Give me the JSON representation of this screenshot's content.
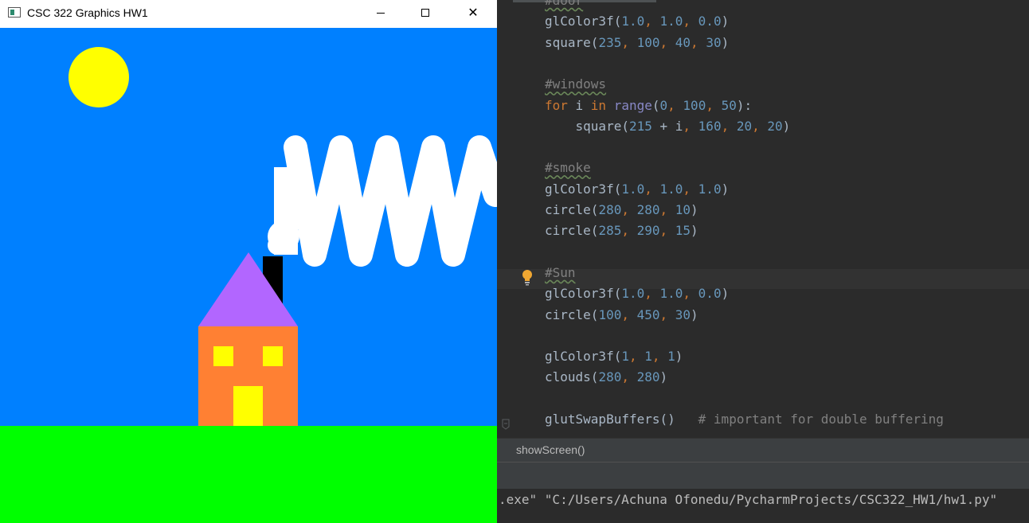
{
  "window": {
    "title": "CSC 322 Graphics HW1",
    "icon": "app-window-icon",
    "controls": [
      "minimize-icon",
      "maximize-icon",
      "close-icon"
    ],
    "close_glyph": "✕"
  },
  "scene": {
    "sky_color": "#0080ff",
    "grass_color": "#00ff00",
    "sun_color": "#ffff00",
    "house_color": "#ff8033",
    "roof_color": "#b266ff",
    "chimney_color": "#000000",
    "door_color": "#ffff00",
    "window_color": "#ffff00",
    "smoke_color": "#ffffff"
  },
  "editor": {
    "lines": [
      {
        "parts": [
          {
            "t": "#door",
            "c": "cm"
          }
        ]
      },
      {
        "parts": [
          {
            "t": "glColor3f("
          },
          {
            "t": "1.0",
            "c": "n"
          },
          {
            "t": ", ",
            "c": "p"
          },
          {
            "t": "1.0",
            "c": "n"
          },
          {
            "t": ", ",
            "c": "p"
          },
          {
            "t": "0.0",
            "c": "n"
          },
          {
            "t": ")"
          }
        ]
      },
      {
        "parts": [
          {
            "t": "square("
          },
          {
            "t": "235",
            "c": "n"
          },
          {
            "t": ", ",
            "c": "p"
          },
          {
            "t": "100",
            "c": "n"
          },
          {
            "t": ", ",
            "c": "p"
          },
          {
            "t": "40",
            "c": "n"
          },
          {
            "t": ", ",
            "c": "p"
          },
          {
            "t": "30",
            "c": "n"
          },
          {
            "t": ")"
          }
        ]
      },
      {
        "parts": []
      },
      {
        "parts": [
          {
            "t": "#windows",
            "c": "cm"
          }
        ]
      },
      {
        "parts": [
          {
            "t": "for ",
            "c": "k"
          },
          {
            "t": "i "
          },
          {
            "t": "in ",
            "c": "k"
          },
          {
            "t": "range",
            "c": "b"
          },
          {
            "t": "("
          },
          {
            "t": "0",
            "c": "n"
          },
          {
            "t": ", ",
            "c": "p"
          },
          {
            "t": "100",
            "c": "n"
          },
          {
            "t": ", ",
            "c": "p"
          },
          {
            "t": "50",
            "c": "n"
          },
          {
            "t": "):"
          }
        ]
      },
      {
        "parts": [
          {
            "t": "    square("
          },
          {
            "t": "215",
            "c": "n"
          },
          {
            "t": " + i"
          },
          {
            "t": ", ",
            "c": "p"
          },
          {
            "t": "160",
            "c": "n"
          },
          {
            "t": ", ",
            "c": "p"
          },
          {
            "t": "20",
            "c": "n"
          },
          {
            "t": ", ",
            "c": "p"
          },
          {
            "t": "20",
            "c": "n"
          },
          {
            "t": ")"
          }
        ]
      },
      {
        "parts": []
      },
      {
        "parts": [
          {
            "t": "#smoke",
            "c": "cm"
          }
        ]
      },
      {
        "parts": [
          {
            "t": "glColor3f("
          },
          {
            "t": "1.0",
            "c": "n"
          },
          {
            "t": ", ",
            "c": "p"
          },
          {
            "t": "1.0",
            "c": "n"
          },
          {
            "t": ", ",
            "c": "p"
          },
          {
            "t": "1.0",
            "c": "n"
          },
          {
            "t": ")"
          }
        ]
      },
      {
        "parts": [
          {
            "t": "circle("
          },
          {
            "t": "280",
            "c": "n"
          },
          {
            "t": ", ",
            "c": "p"
          },
          {
            "t": "280",
            "c": "n"
          },
          {
            "t": ", ",
            "c": "p"
          },
          {
            "t": "10",
            "c": "n"
          },
          {
            "t": ")"
          }
        ]
      },
      {
        "parts": [
          {
            "t": "circle("
          },
          {
            "t": "285",
            "c": "n"
          },
          {
            "t": ", ",
            "c": "p"
          },
          {
            "t": "290",
            "c": "n"
          },
          {
            "t": ", ",
            "c": "p"
          },
          {
            "t": "15",
            "c": "n"
          },
          {
            "t": ")"
          }
        ]
      },
      {
        "parts": []
      },
      {
        "parts": [
          {
            "t": "#Sun",
            "c": "cm"
          }
        ]
      },
      {
        "parts": [
          {
            "t": "glColor3f("
          },
          {
            "t": "1.0",
            "c": "n"
          },
          {
            "t": ", ",
            "c": "p"
          },
          {
            "t": "1.0",
            "c": "n"
          },
          {
            "t": ", ",
            "c": "p"
          },
          {
            "t": "0.0",
            "c": "n"
          },
          {
            "t": ")"
          }
        ]
      },
      {
        "parts": [
          {
            "t": "circle("
          },
          {
            "t": "100",
            "c": "n"
          },
          {
            "t": ", ",
            "c": "p"
          },
          {
            "t": "450",
            "c": "n"
          },
          {
            "t": ", ",
            "c": "p"
          },
          {
            "t": "30",
            "c": "n"
          },
          {
            "t": ")"
          }
        ]
      },
      {
        "parts": []
      },
      {
        "parts": [
          {
            "t": "glColor3f("
          },
          {
            "t": "1",
            "c": "n"
          },
          {
            "t": ", ",
            "c": "p"
          },
          {
            "t": "1",
            "c": "n"
          },
          {
            "t": ", ",
            "c": "p"
          },
          {
            "t": "1",
            "c": "n"
          },
          {
            "t": ")"
          }
        ]
      },
      {
        "parts": [
          {
            "t": "clouds("
          },
          {
            "t": "280",
            "c": "n"
          },
          {
            "t": ", ",
            "c": "p"
          },
          {
            "t": "280",
            "c": "n"
          },
          {
            "t": ")"
          }
        ]
      },
      {
        "parts": []
      },
      {
        "parts": [
          {
            "t": "glutSwapBuffers()   "
          },
          {
            "t": "# important for double buffering",
            "c": "c"
          }
        ]
      }
    ]
  },
  "breadcrumb": {
    "label": "showScreen()"
  },
  "console": {
    "text": ".exe\" \"C:/Users/Achuna Ofonedu/PycharmProjects/CSC322_HW1/hw1.py\""
  }
}
